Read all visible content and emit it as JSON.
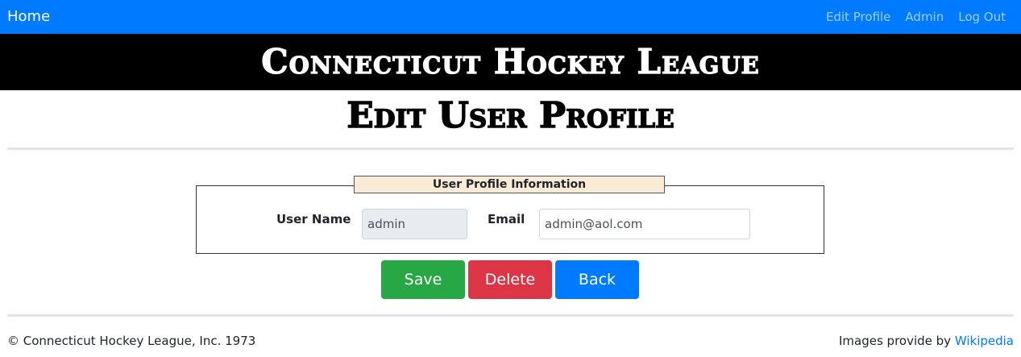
{
  "navbar": {
    "brand": "Home",
    "links": [
      "Edit Profile",
      "Admin",
      "Log Out"
    ],
    "color": "#007bff"
  },
  "banner": {
    "title": "Connecticut Hockey League"
  },
  "page": {
    "title": "Edit User Profile"
  },
  "form": {
    "legend": "User Profile Information",
    "user_name_label": "User Name",
    "user_name_value": "admin",
    "email_label": "Email",
    "email_value": "admin@aol.com"
  },
  "buttons": {
    "save": "Save",
    "delete": "Delete",
    "back": "Back"
  },
  "footer": {
    "copyright": "© Connecticut Hockey League, Inc. 1973",
    "images_text": "Images provide by",
    "images_link": "Wikipedia"
  },
  "colors": {
    "primary": "#007bff",
    "success": "#28a745",
    "danger": "#dc3545",
    "legend_bg": "#faebd7"
  }
}
